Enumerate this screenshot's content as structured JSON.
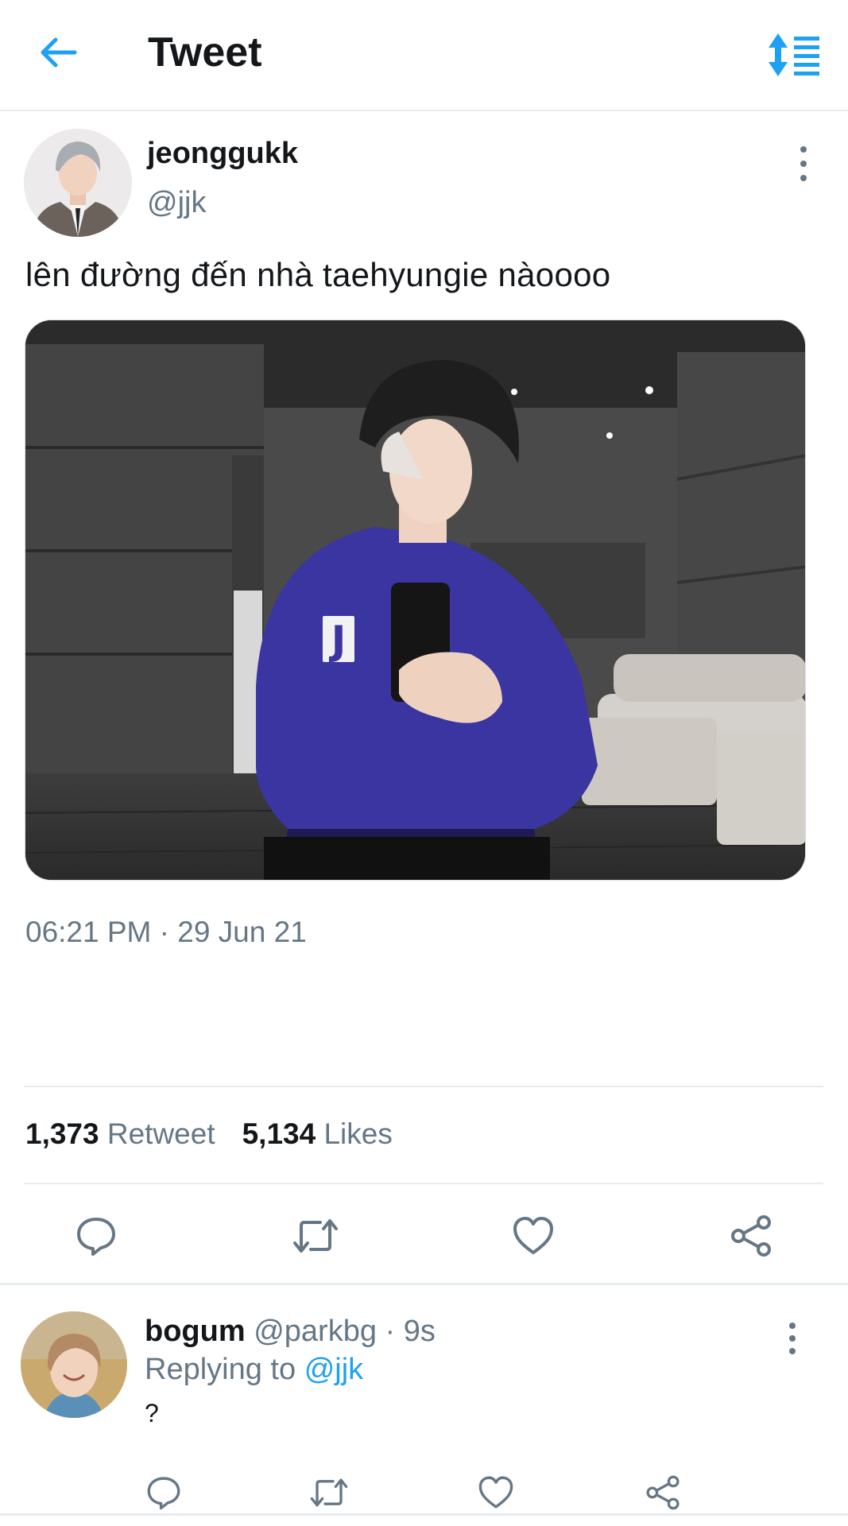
{
  "header": {
    "title": "Tweet",
    "back_icon": "arrow-left-icon",
    "sort_icon": "sort-lines-icon",
    "accent": "#1da1f2"
  },
  "tweet": {
    "display_name": "jeonggukk",
    "handle": "@jjk",
    "text": "lên đường đến nhà taehyungie nàoooo",
    "timestamp": "06:21 PM · 29 Jun 21",
    "retweet_count": "1,373",
    "retweet_label": "Retweet",
    "likes_count": "5,134",
    "likes_label": "Likes",
    "more_icon": "more-vertical-icon",
    "actions": [
      "comment-icon",
      "retweet-icon",
      "heart-icon",
      "share-icon"
    ]
  },
  "reply": {
    "display_name": "bogum",
    "meta": "@parkbg · 9s",
    "replying_prefix": "Replying to",
    "replying_mention": "@jjk",
    "text": "?",
    "actions": [
      "comment-icon",
      "retweet-icon",
      "heart-icon",
      "share-icon"
    ]
  },
  "colors": {
    "text_primary": "#14171a",
    "text_secondary": "#657786",
    "divider": "#e6ecf0",
    "link": "#1da1f2"
  }
}
